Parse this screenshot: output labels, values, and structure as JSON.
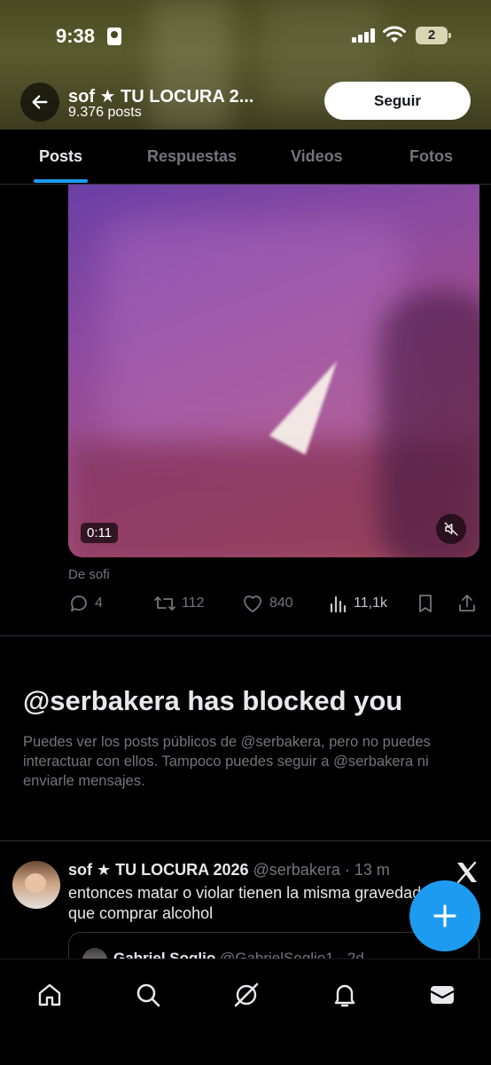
{
  "status_bar": {
    "time": "9:38",
    "battery": "2"
  },
  "header": {
    "profile_name": "sof ★ TU LOCURA 2...",
    "post_count": "9.376 posts",
    "follow_label": "Seguir"
  },
  "tabs": [
    {
      "label": "Posts",
      "active": true
    },
    {
      "label": "Respuestas",
      "active": false
    },
    {
      "label": "Videos",
      "active": false
    },
    {
      "label": "Fotos",
      "active": false
    }
  ],
  "video": {
    "duration": "0:11"
  },
  "post": {
    "source": "De sofi",
    "replies": "4",
    "reposts": "112",
    "likes": "840",
    "views": "11,1k"
  },
  "blocked": {
    "title": "@serbakera has blocked you",
    "description": "Puedes ver los posts públicos de @serbakera, pero no puedes interactuar con ellos. Tampoco puedes seguir a @serbakera ni enviarle mensajes."
  },
  "tweet": {
    "name": "sof ★ TU LOCURA 2026",
    "meta": "@serbakera · 13 m",
    "text": "entonces matar o violar tienen la misma gravedad que comprar alcohol",
    "quote_name": "Gabriel Soglio",
    "quote_meta": "@GabrielSoglio1 · 2d"
  },
  "colors": {
    "accent": "#1d9bf0",
    "background": "#000000",
    "muted": "#71767b",
    "text": "#e7e9ea"
  },
  "icons": {
    "back": "arrow-left-icon",
    "mute": "speaker-muted-icon",
    "reply": "reply-icon",
    "repost": "repost-icon",
    "like": "heart-icon",
    "views": "views-chart-icon",
    "bookmark": "bookmark-icon",
    "share": "share-icon",
    "compose": "plus-icon",
    "nav": [
      "home-icon",
      "search-icon",
      "grok-icon",
      "bell-icon",
      "mail-icon"
    ]
  }
}
